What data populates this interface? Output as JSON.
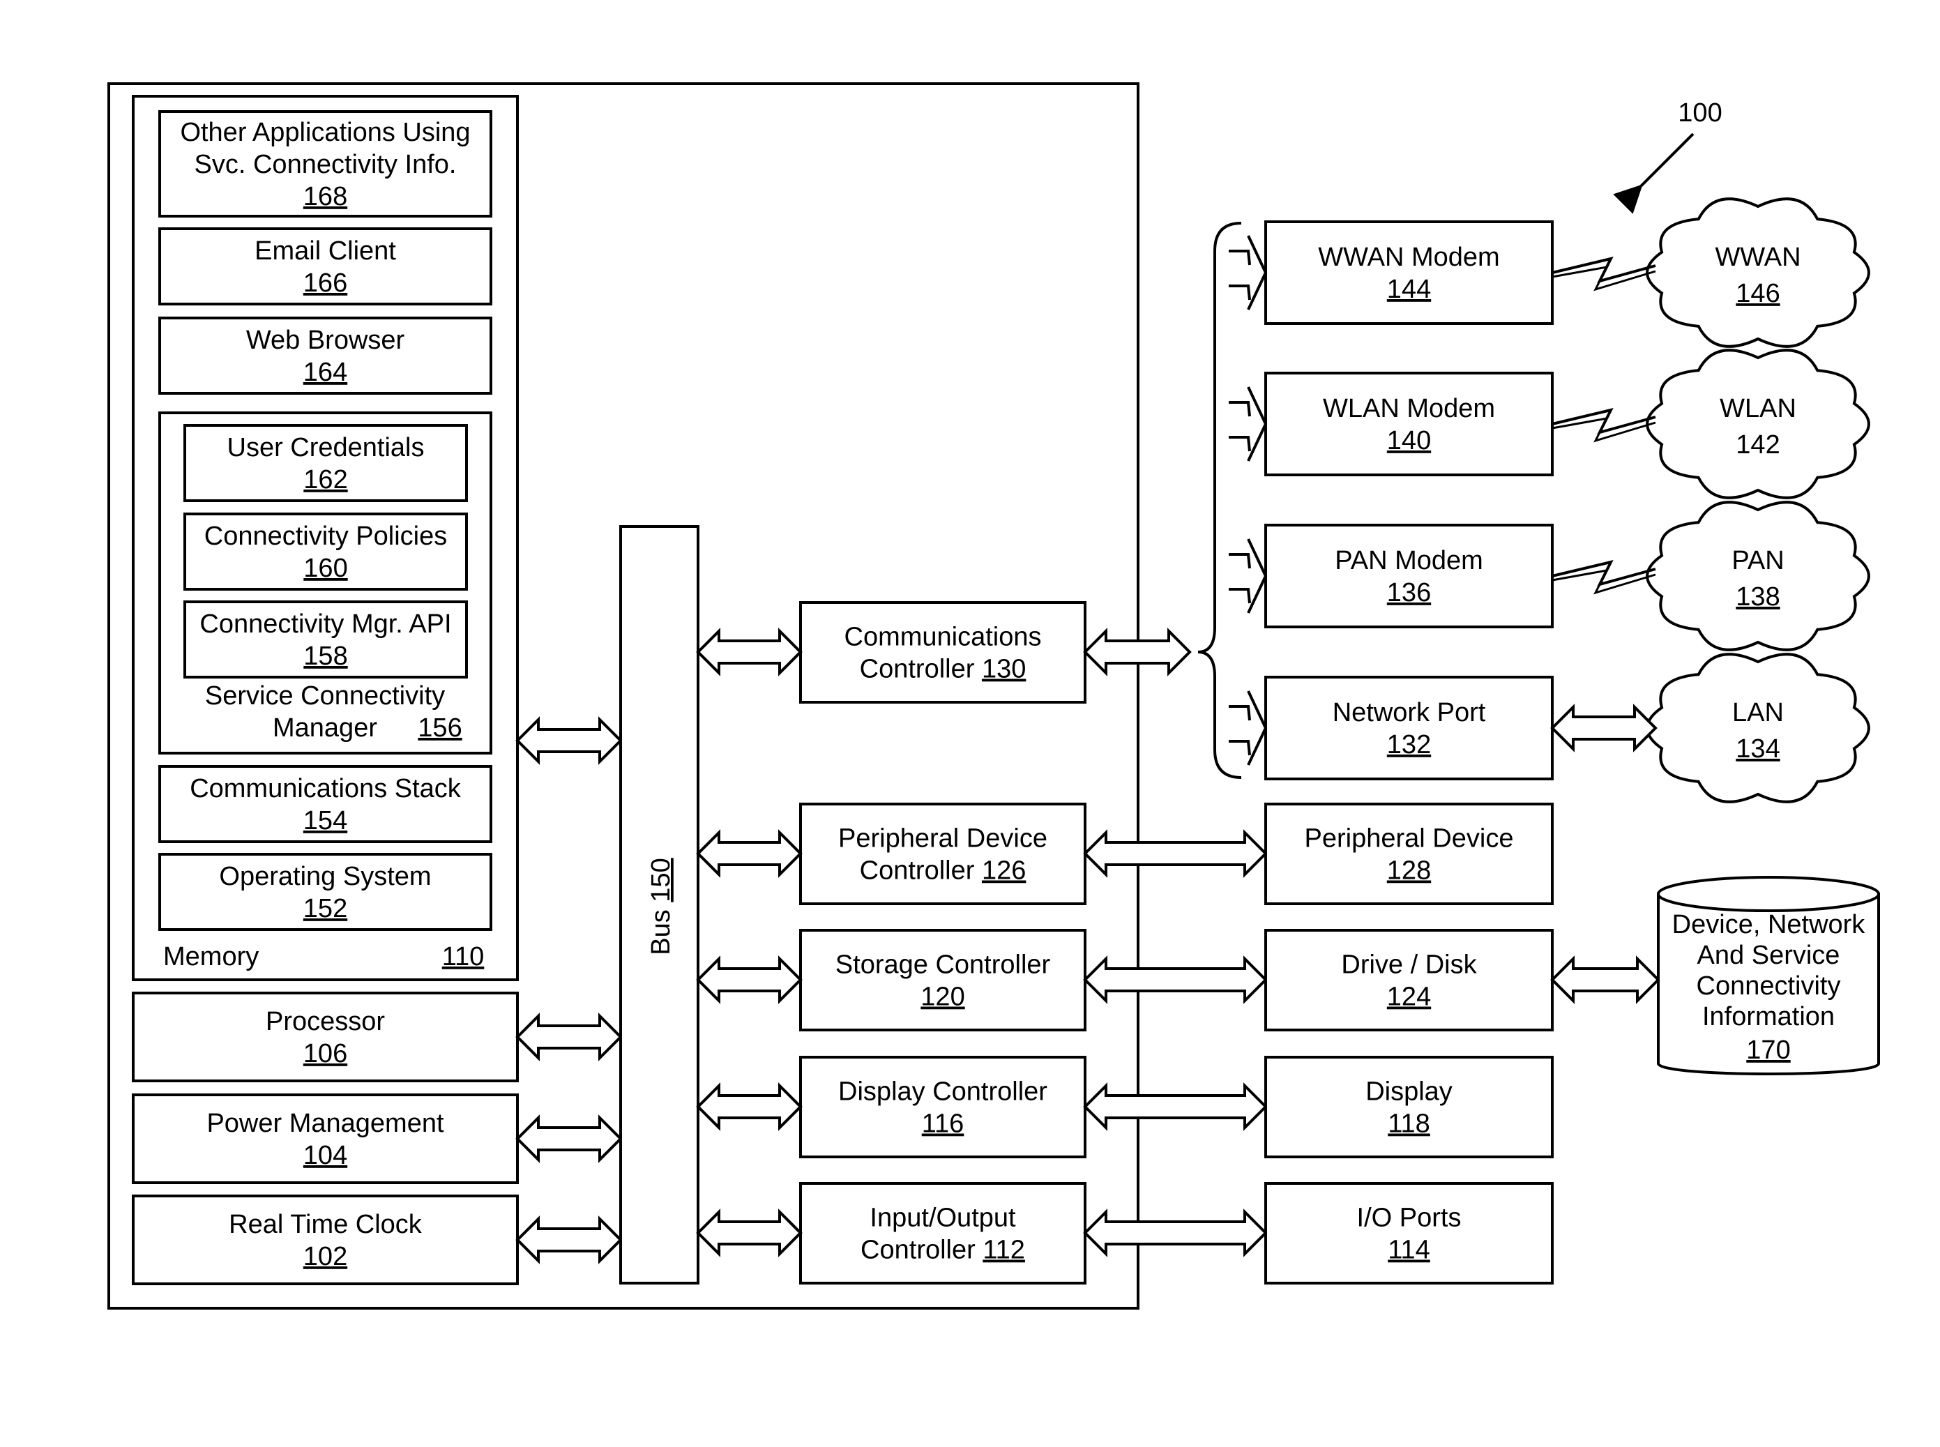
{
  "figure": {
    "reference": "100"
  },
  "memory": {
    "label": "Memory",
    "ref": "110",
    "items": [
      {
        "lines": [
          "Other Applications Using",
          "Svc. Connectivity  Info."
        ],
        "ref": "168"
      },
      {
        "lines": [
          "Email Client"
        ],
        "ref": "166"
      },
      {
        "lines": [
          "Web Browser"
        ],
        "ref": "164"
      },
      {
        "lines": [
          "Communications Stack"
        ],
        "ref": "154"
      },
      {
        "lines": [
          "Operating System"
        ],
        "ref": "152"
      }
    ],
    "service_manager": {
      "lines": [
        "Service Connectivity",
        "Manager"
      ],
      "ref": "156",
      "items": [
        {
          "lines": [
            "User Credentials"
          ],
          "ref": "162"
        },
        {
          "lines": [
            "Connectivity Policies"
          ],
          "ref": "160"
        },
        {
          "lines": [
            "Connectivity Mgr. API"
          ],
          "ref": "158"
        }
      ]
    }
  },
  "system_blocks": [
    {
      "lines": [
        "Processor"
      ],
      "ref": "106"
    },
    {
      "lines": [
        "Power Management"
      ],
      "ref": "104"
    },
    {
      "lines": [
        "Real Time Clock"
      ],
      "ref": "102"
    }
  ],
  "bus": {
    "label": "Bus",
    "ref": "150"
  },
  "controllers": [
    {
      "lines": [
        "Communications",
        "Controller"
      ],
      "ref": "130",
      "inline_ref": true
    },
    {
      "lines": [
        "Peripheral Device",
        "Controller"
      ],
      "ref": "126",
      "inline_ref": true
    },
    {
      "lines": [
        "Storage Controller"
      ],
      "ref": "120",
      "inline_ref": false
    },
    {
      "lines": [
        "Display Controller"
      ],
      "ref": "116",
      "inline_ref": false
    },
    {
      "lines": [
        "Input/Output",
        "Controller"
      ],
      "ref": "112",
      "inline_ref": true
    }
  ],
  "comm_devices": [
    {
      "lines": [
        "WWAN Modem"
      ],
      "ref": "144",
      "network": {
        "name": "WWAN",
        "ref": "146",
        "ref_underlined": true
      },
      "link": "wireless"
    },
    {
      "lines": [
        "WLAN Modem"
      ],
      "ref": "140",
      "network": {
        "name": "WLAN",
        "ref": "142",
        "ref_underlined": false
      },
      "link": "wireless"
    },
    {
      "lines": [
        "PAN Modem"
      ],
      "ref": "136",
      "network": {
        "name": "PAN",
        "ref": "138",
        "ref_underlined": true
      },
      "link": "wireless"
    },
    {
      "lines": [
        "Network Port"
      ],
      "ref": "132",
      "network": {
        "name": "LAN",
        "ref": "134",
        "ref_underlined": true
      },
      "link": "wired"
    }
  ],
  "peripherals": [
    {
      "lines": [
        "Peripheral Device"
      ],
      "ref": "128"
    },
    {
      "lines": [
        "Drive / Disk"
      ],
      "ref": "124"
    },
    {
      "lines": [
        "Display"
      ],
      "ref": "118"
    },
    {
      "lines": [
        "I/O Ports"
      ],
      "ref": "114"
    }
  ],
  "database": {
    "lines": [
      "Device, Network",
      "And Service",
      "Connectivity",
      "Information"
    ],
    "ref": "170"
  }
}
